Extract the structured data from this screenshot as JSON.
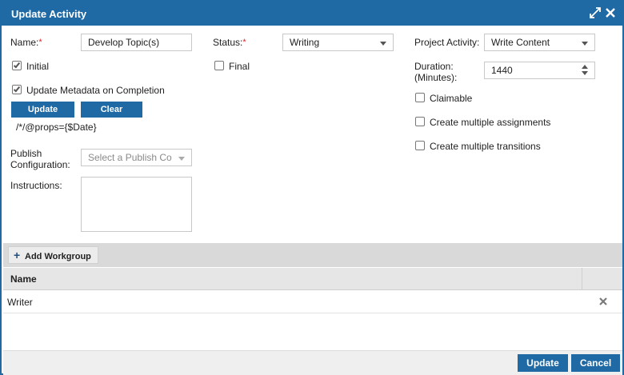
{
  "dialog": {
    "title": "Update Activity",
    "maximize_icon": "expand-arrows-icon",
    "close_icon": "close-icon"
  },
  "form": {
    "name_label": "Name:",
    "name_value": "Develop Topic(s)",
    "required_marker": "*",
    "status_label": "Status:",
    "status_value": "Writing",
    "project_activity_label": "Project Activity:",
    "project_activity_value": "Write Content",
    "initial_label": "Initial",
    "initial_checked": true,
    "final_label": "Final",
    "final_checked": false,
    "duration_label_line1": "Duration:",
    "duration_label_line2": "(Minutes):",
    "duration_value": "1440",
    "update_metadata_label": "Update Metadata on Completion",
    "update_metadata_checked": true,
    "update_button": "Update",
    "clear_button": "Clear",
    "props_text": "/*/@props={$Date}",
    "claimable_label": "Claimable",
    "claimable_checked": false,
    "multiple_assignments_label": "Create multiple assignments",
    "multiple_assignments_checked": false,
    "multiple_transitions_label": "Create multiple transitions",
    "multiple_transitions_checked": false,
    "publish_label_line1": "Publish",
    "publish_label_line2": "Configuration:",
    "publish_placeholder": "Select a Publish Co",
    "instructions_label": "Instructions:",
    "instructions_value": ""
  },
  "workgroups": {
    "add_button": "Add Workgroup",
    "columns": [
      "Name"
    ],
    "rows": [
      {
        "name": "Writer"
      }
    ]
  },
  "footer": {
    "update_button": "Update",
    "cancel_button": "Cancel"
  },
  "colors": {
    "accent": "#1f6aa5",
    "required": "#d9242a"
  }
}
